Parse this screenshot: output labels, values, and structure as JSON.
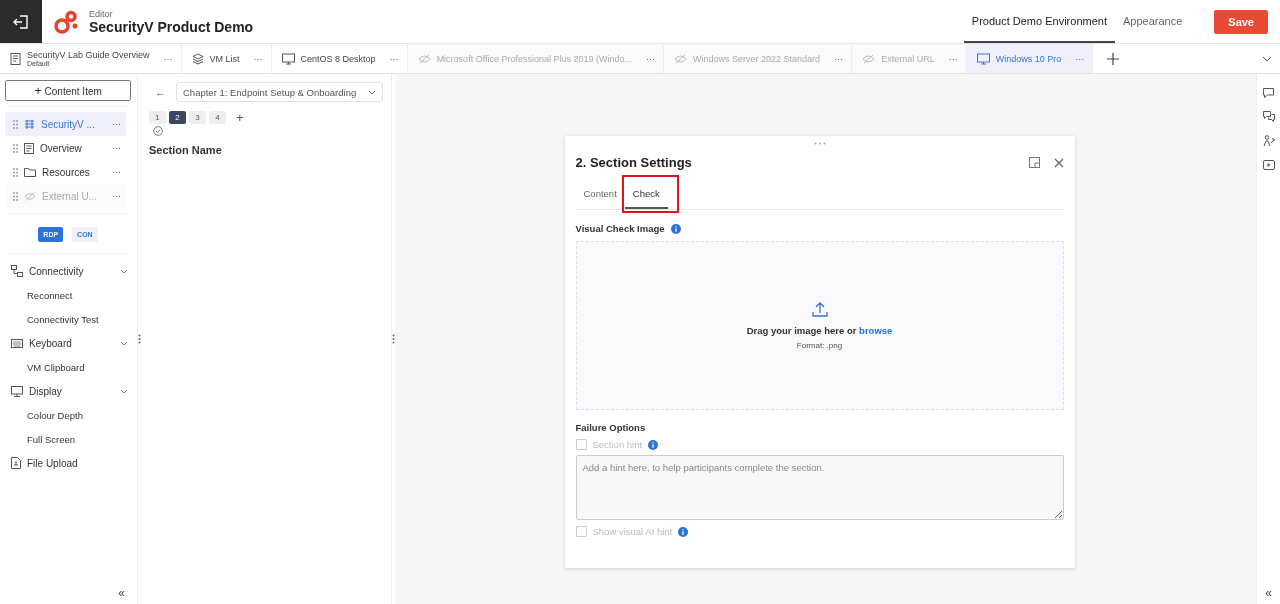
{
  "header": {
    "eyebrow": "Editor",
    "title": "SecurityV Product Demo",
    "nav": [
      {
        "label": "Product Demo Environment",
        "selected": true
      },
      {
        "label": "Appearance",
        "selected": false
      }
    ],
    "save": "Save"
  },
  "env_tabs": [
    {
      "kind": "doc",
      "label": "SecurityV Lab Guide Overview",
      "subtitle": "Default",
      "hidden": false,
      "selected": false,
      "more": "···"
    },
    {
      "kind": "stack",
      "label": "VM List",
      "hidden": false,
      "selected": false,
      "more": "···"
    },
    {
      "kind": "monitor",
      "label": "CentOS 8 Desktop",
      "hidden": false,
      "selected": false,
      "more": "···"
    },
    {
      "kind": "eye",
      "label": "Microsoft Office Professional Plus 2019 (Windo...",
      "hidden": true,
      "selected": false,
      "more": "···"
    },
    {
      "kind": "eye",
      "label": "Windows Server 2022 Standard",
      "hidden": true,
      "selected": false,
      "more": "···"
    },
    {
      "kind": "eye",
      "label": "External URL",
      "hidden": true,
      "selected": false,
      "more": "···"
    },
    {
      "kind": "monitor",
      "label": "Windows 10 Pro",
      "hidden": false,
      "selected": true,
      "more": "···"
    }
  ],
  "sidebar": {
    "add_icon": "+",
    "add_button": "Content Item",
    "items": [
      {
        "kind": "guide",
        "label": "SecurityV ...",
        "selected": true,
        "hidden": false,
        "more": "···"
      },
      {
        "kind": "doc",
        "label": "Overview",
        "selected": false,
        "hidden": false,
        "more": "···"
      },
      {
        "kind": "folder",
        "label": "Resources",
        "selected": false,
        "hidden": false,
        "more": "···"
      },
      {
        "kind": "eye",
        "label": "External U...",
        "selected": false,
        "hidden": true,
        "more": "···"
      }
    ],
    "modes": [
      {
        "label": "RDP",
        "selected": true
      },
      {
        "label": "CON",
        "selected": false
      }
    ],
    "menu": [
      {
        "kind": "link",
        "label": "Connectivity",
        "expanded": true,
        "children": [
          {
            "label": "Reconnect"
          },
          {
            "label": "Connectivity Test"
          }
        ]
      },
      {
        "kind": "keyboard",
        "label": "Keyboard",
        "expanded": true,
        "children": [
          {
            "label": "VM Clipboard"
          }
        ]
      },
      {
        "kind": "display",
        "label": "Display",
        "expanded": true,
        "children": [
          {
            "label": "Colour Depth"
          },
          {
            "label": "Full Screen"
          }
        ]
      },
      {
        "kind": "upload",
        "label": "File Upload"
      }
    ],
    "collapse": "«"
  },
  "editor": {
    "back": "←",
    "chapter": "Chapter 1: Endpoint Setup & Onboarding",
    "sections": [
      {
        "label": "1",
        "selected": false
      },
      {
        "label": "2",
        "selected": true
      },
      {
        "label": "3",
        "selected": false
      },
      {
        "label": "4",
        "selected": false
      }
    ],
    "add": "+",
    "section_name": "Section Name"
  },
  "dialog": {
    "title": "2. Section Settings",
    "tabs": [
      {
        "label": "Content",
        "selected": false,
        "highlighted": false
      },
      {
        "label": "Check",
        "selected": true,
        "highlighted": true
      }
    ],
    "image_label": "Visual Check Image",
    "drop_text": "Drag your image here or ",
    "browse": "browse",
    "format": "Format: .png",
    "failure_title": "Failure Options",
    "section_hint": {
      "label": "Section hint",
      "checked": false,
      "disabled": true
    },
    "hint_placeholder": "Add a hint here, to help participants complete the section.",
    "ai_hint": {
      "label": "Show visual AI hint",
      "checked": false,
      "disabled": true
    }
  },
  "right_rail": {
    "collapse": "«"
  }
}
